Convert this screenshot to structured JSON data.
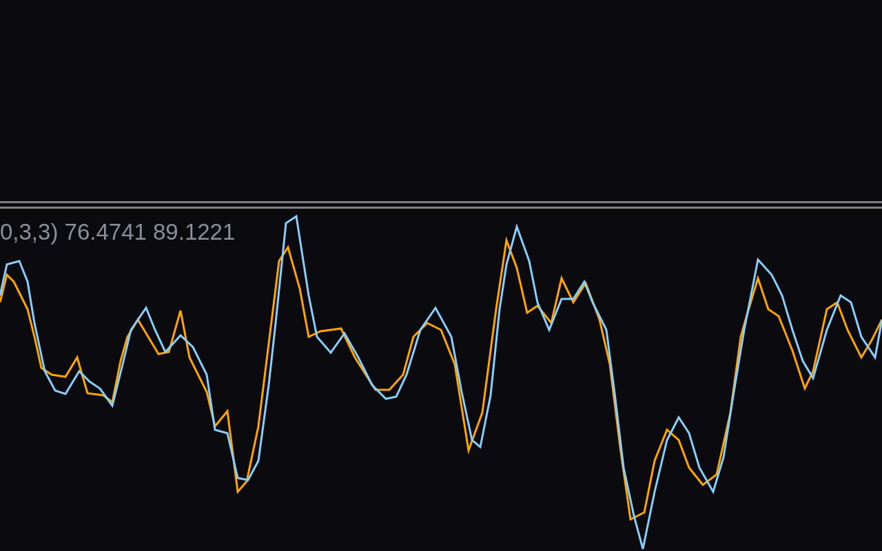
{
  "indicator": {
    "label": "0,3,3) 76.4741 89.1221"
  }
}
